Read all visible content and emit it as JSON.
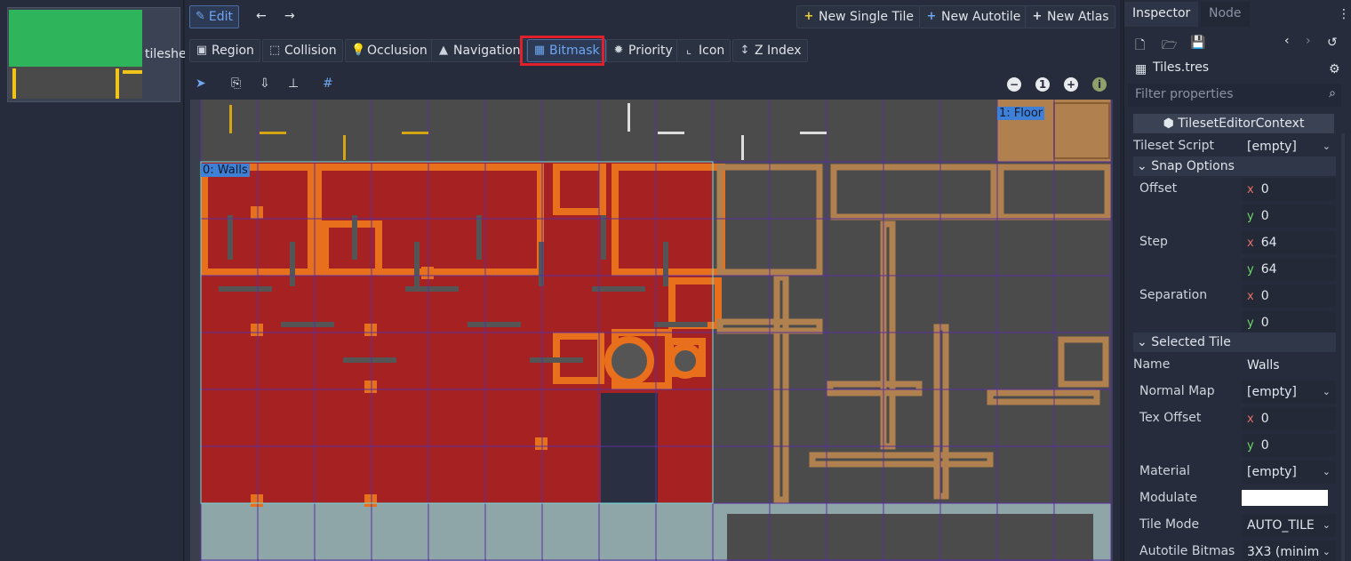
{
  "texture_list": {
    "item_label": "tileshe"
  },
  "editor": {
    "top_bar": {
      "edit_label": "Edit",
      "new_single_tile": "New Single Tile",
      "new_autotile": "New Autotile",
      "new_atlas": "New Atlas"
    },
    "modes": {
      "region": "Region",
      "collision": "Collision",
      "occlusion": "Occlusion",
      "navigation": "Navigation",
      "bitmask": "Bitmask",
      "priority": "Priority",
      "icon": "Icon",
      "z_index": "Z Index"
    },
    "zoom_reset_label": "1",
    "tile_labels": {
      "walls": "0: Walls",
      "floor": "1: Floor"
    }
  },
  "inspector": {
    "tabs": {
      "inspector": "Inspector",
      "node": "Node"
    },
    "resource_name": "Tiles.tres",
    "filter_placeholder": "Filter properties",
    "context_title": "TilesetEditorContext",
    "tileset_script": {
      "label": "Tileset Script",
      "value": "[empty]"
    },
    "snap_options": "Snap Options",
    "offset": {
      "label": "Offset",
      "x": "0",
      "y": "0"
    },
    "step": {
      "label": "Step",
      "x": "64",
      "y": "64"
    },
    "separation": {
      "label": "Separation",
      "x": "0",
      "y": "0"
    },
    "selected_tile": "Selected Tile",
    "name": {
      "label": "Name",
      "value": "Walls"
    },
    "normal_map": {
      "label": "Normal Map",
      "value": "[empty]"
    },
    "tex_offset": {
      "label": "Tex Offset",
      "x": "0",
      "y": "0"
    },
    "material": {
      "label": "Material",
      "value": "[empty]"
    },
    "modulate": {
      "label": "Modulate",
      "color": "#ffffff"
    },
    "tile_mode": {
      "label": "Tile Mode",
      "value": "AUTO_TILE"
    },
    "autotile_bitmask": {
      "label": "Autotile Bitmas",
      "value": "3X3 (minim"
    }
  },
  "colors": {
    "accent": "#6fa6ef",
    "highlight": "#e0202a",
    "wall_red": "#a62121",
    "wall_orange": "#e8701c",
    "floor_tan": "#b0804e",
    "grid_purple": "#5a2fa0"
  }
}
